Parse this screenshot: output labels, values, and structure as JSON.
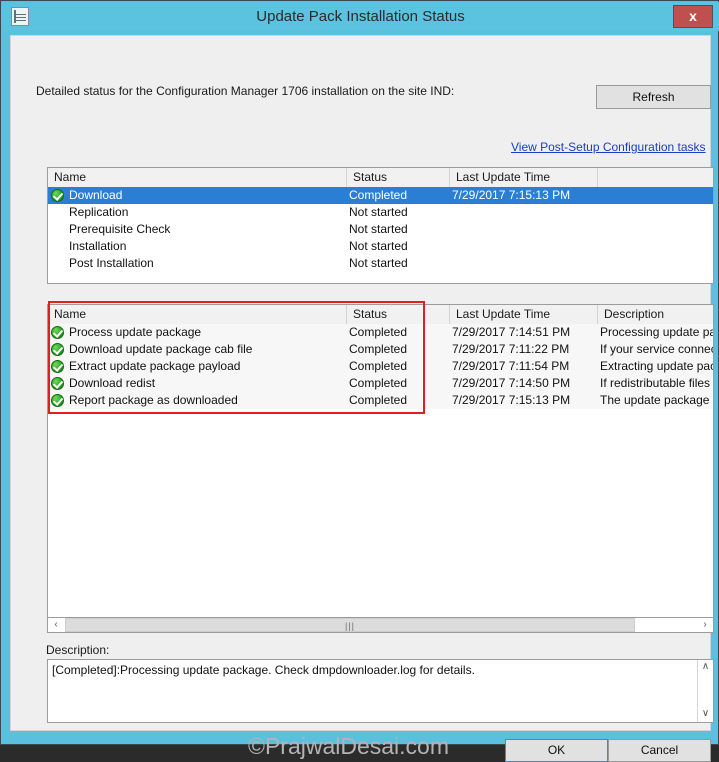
{
  "window": {
    "title": "Update Pack Installation Status",
    "close_label": "x",
    "icon": "document-lines-icon"
  },
  "header": {
    "intro_text": "Detailed status for the Configuration Manager 1706 installation on the site IND:",
    "refresh_label": "Refresh",
    "post_setup_link": "View Post-Setup Configuration tasks"
  },
  "phases_table": {
    "columns": [
      "Name",
      "Status",
      "Last Update Time"
    ],
    "sorted_column": "Name",
    "sort_direction": "ascending",
    "rows": [
      {
        "name": "Download",
        "status": "Completed",
        "last_update": "7/29/2017 7:15:13 PM",
        "icon": "green-check-icon",
        "selected": true
      },
      {
        "name": "Replication",
        "status": "Not started",
        "last_update": "",
        "icon": "",
        "selected": false
      },
      {
        "name": "Prerequisite Check",
        "status": "Not started",
        "last_update": "",
        "icon": "",
        "selected": false
      },
      {
        "name": "Installation",
        "status": "Not started",
        "last_update": "",
        "icon": "",
        "selected": false
      },
      {
        "name": "Post Installation",
        "status": "Not started",
        "last_update": "",
        "icon": "",
        "selected": false
      }
    ]
  },
  "tasks_table": {
    "columns": [
      "Name",
      "Status",
      "Last Update Time",
      "Description"
    ],
    "sorted_column": "Name",
    "sort_direction": "ascending",
    "rows": [
      {
        "name": "Process update package",
        "status": "Completed",
        "last_update": "7/29/2017 7:14:51 PM",
        "description": "Processing update pac",
        "icon": "green-check-icon"
      },
      {
        "name": "Download update package cab file",
        "status": "Completed",
        "last_update": "7/29/2017 7:11:22 PM",
        "description": "If your service connec",
        "icon": "green-check-icon"
      },
      {
        "name": "Extract update package payload",
        "status": "Completed",
        "last_update": "7/29/2017 7:11:54 PM",
        "description": "Extracting update pac",
        "icon": "green-check-icon"
      },
      {
        "name": "Download redist",
        "status": "Completed",
        "last_update": "7/29/2017 7:14:50 PM",
        "description": "If redistributable files a",
        "icon": "green-check-icon"
      },
      {
        "name": "Report package as downloaded",
        "status": "Completed",
        "last_update": "7/29/2017 7:15:13 PM",
        "description": "The update package l",
        "icon": "green-check-icon"
      }
    ]
  },
  "scrollbar": {
    "left_arrow": "‹",
    "right_arrow": "›",
    "grip": "|||",
    "up_arrow": "∧",
    "down_arrow": "∨"
  },
  "description": {
    "label": "Description:",
    "text": "[Completed]:Processing update package. Check dmpdownloader.log for details."
  },
  "footer": {
    "watermark": "©PrajwalDesai.com",
    "ok_label": "OK",
    "cancel_label": "Cancel"
  },
  "colors": {
    "accent": "#5bc3e0",
    "selection": "#2a7fd4",
    "close_button": "#c0504d",
    "link": "#1a3fbf",
    "annotation": "#e02020",
    "success": "#29a329"
  }
}
